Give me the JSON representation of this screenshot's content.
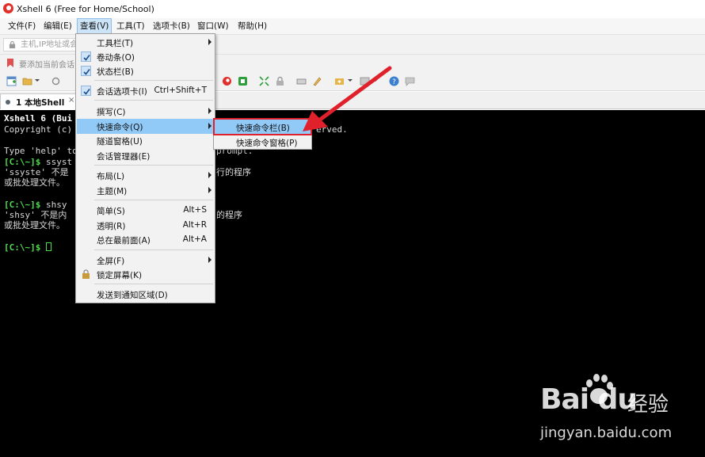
{
  "window": {
    "title": "Xshell 6 (Free for Home/School)"
  },
  "menubar": {
    "items": [
      {
        "label": "文件(F)",
        "active": false
      },
      {
        "label": "编辑(E)",
        "active": false
      },
      {
        "label": "查看(V)",
        "active": true
      },
      {
        "label": "工具(T)",
        "active": false
      },
      {
        "label": "选项卡(B)",
        "active": false
      },
      {
        "label": "窗口(W)",
        "active": false
      },
      {
        "label": "帮助(H)",
        "active": false
      }
    ]
  },
  "addressbar": {
    "placeholder": "主机,IP地址或会"
  },
  "linksbar": {
    "text": "要添加当前会话"
  },
  "tab": {
    "label": "1 本地Shell",
    "close_glyph": "×"
  },
  "terminal": {
    "lines": [
      {
        "text": "Xshell 6 (Bui",
        "bold": true
      },
      {
        "text": "Copyright (c)",
        "tail": "erved."
      },
      {
        "text": ""
      },
      {
        "text": "Type 'help' to",
        "tail": "prompt."
      },
      {
        "prompt": "[C:\\~]$",
        "text": " ssyst"
      },
      {
        "text": "'ssyste' 不是",
        "tail": "行的程序"
      },
      {
        "text": "或批处理文件。"
      },
      {
        "text": ""
      },
      {
        "prompt": "[C:\\~]$",
        "text": " shsy"
      },
      {
        "text": "'shsy' 不是内",
        "tail": "的程序"
      },
      {
        "text": "或批处理文件。"
      },
      {
        "text": ""
      },
      {
        "prompt": "[C:\\~]$",
        "text": " ",
        "cursor": true
      }
    ]
  },
  "view_menu": {
    "items": [
      {
        "label": "工具栏(T)",
        "shortcut": "",
        "checked": false,
        "submenu": true
      },
      {
        "label": "卷动条(O)",
        "shortcut": "",
        "checked": true,
        "submenu": false
      },
      {
        "label": "状态栏(B)",
        "shortcut": "",
        "checked": true,
        "submenu": false
      },
      {
        "label": "会话选项卡(I)",
        "shortcut": "Ctrl+Shift+T",
        "checked": true,
        "submenu": false
      },
      {
        "label": "撰写(C)",
        "shortcut": "",
        "checked": false,
        "submenu": true
      },
      {
        "label": "快速命令(Q)",
        "shortcut": "",
        "checked": false,
        "submenu": true,
        "highlight": true
      },
      {
        "label": "隧道窗格(U)",
        "shortcut": "",
        "checked": false,
        "submenu": false
      },
      {
        "label": "会话管理器(E)",
        "shortcut": "",
        "checked": false,
        "submenu": false
      },
      {
        "label": "布局(L)",
        "shortcut": "",
        "checked": false,
        "submenu": true
      },
      {
        "label": "主题(M)",
        "shortcut": "",
        "checked": false,
        "submenu": true
      },
      {
        "label": "简单(S)",
        "shortcut": "Alt+S",
        "checked": false,
        "submenu": false
      },
      {
        "label": "透明(R)",
        "shortcut": "Alt+R",
        "checked": false,
        "submenu": false
      },
      {
        "label": "总在最前面(A)",
        "shortcut": "Alt+A",
        "checked": false,
        "submenu": false
      },
      {
        "label": "全屏(F)",
        "shortcut": "",
        "checked": false,
        "submenu": true
      },
      {
        "label": "锁定屏幕(K)",
        "shortcut": "",
        "checked": false,
        "submenu": false,
        "icon": "lock-icon"
      },
      {
        "label": "发送到通知区域(D)",
        "shortcut": "",
        "checked": false,
        "submenu": false
      }
    ]
  },
  "quick_command_submenu": {
    "items": [
      {
        "label": "快速命令栏(B)",
        "highlight": true
      },
      {
        "label": "快速命令窗格(P)",
        "highlight": false
      }
    ]
  },
  "watermark": {
    "logo": "Bai  du",
    "brand": "经验",
    "url": "jingyan.baidu.com"
  },
  "colors": {
    "terminal_bg": "#000000",
    "prompt_green": "#4fdc4f",
    "menu_highlight": "#91c9f7",
    "callout_red": "#e0202a"
  }
}
